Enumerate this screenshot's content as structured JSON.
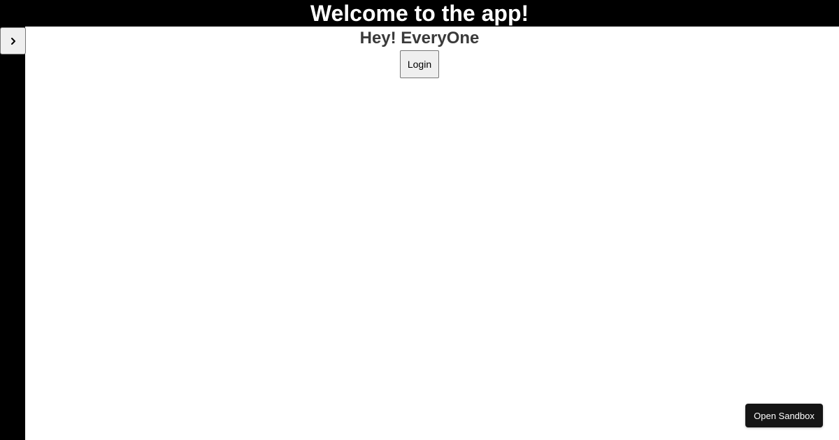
{
  "header": {
    "title": "Welcome to the app!"
  },
  "sidebar": {
    "toggle_icon": "chevron-right-icon"
  },
  "main": {
    "greeting": "Hey! EveryOne",
    "login_label": "Login"
  },
  "floating": {
    "sandbox_label": "Open Sandbox"
  },
  "colors": {
    "header_bg": "#000000",
    "header_text": "#ffffff",
    "sidebar_bg": "#000000",
    "greeting_text": "#3a3a3a",
    "sandbox_bg": "#151515"
  }
}
